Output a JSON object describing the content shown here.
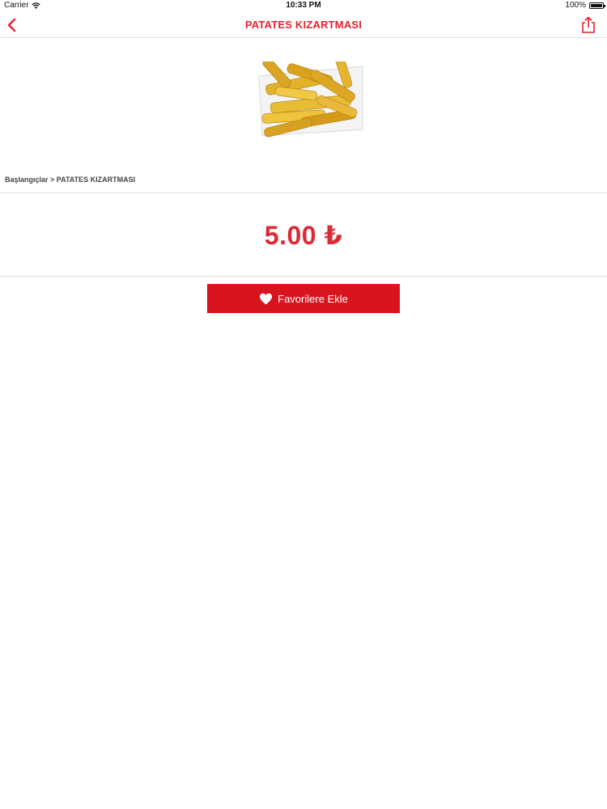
{
  "status_bar": {
    "carrier": "Carrier",
    "time": "10:33 PM",
    "battery": "100%",
    "battery_level": 1.0
  },
  "nav": {
    "title": "PATATES KIZARTMASI",
    "back_icon": "chevron-left-icon",
    "share_icon": "share-icon"
  },
  "product": {
    "breadcrumb": "Başlangıçlar > PATATES KIZARTMASI",
    "price": "5.00 ₺"
  },
  "actions": {
    "favorite_label": "Favorilere Ekle",
    "favorite_icon": "heart-icon"
  },
  "colors": {
    "accent": "#e2222f",
    "button": "#d8141f"
  }
}
